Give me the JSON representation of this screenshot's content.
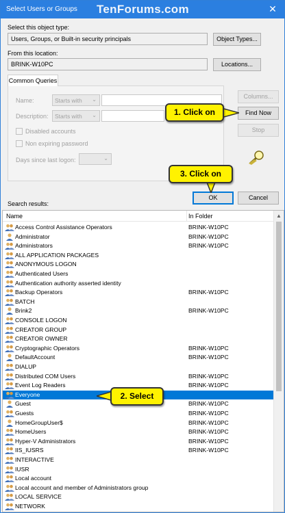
{
  "window": {
    "title": "Select Users or Groups",
    "watermark": "TenForums.com",
    "close_glyph": "✕"
  },
  "object_type": {
    "label": "Select this object type:",
    "value": "Users, Groups, or Built-in security principals",
    "button": "Object Types..."
  },
  "location": {
    "label": "From this location:",
    "value": "BRINK-W10PC",
    "button": "Locations..."
  },
  "common_queries": {
    "tab": "Common Queries",
    "name_label": "Name:",
    "name_mode": "Starts with",
    "description_label": "Description:",
    "description_mode": "Starts with",
    "disabled_accounts": "Disabled accounts",
    "non_expiring_password": "Non expiring password",
    "days_label": "Days since last logon:"
  },
  "side_buttons": {
    "columns": "Columns...",
    "find_now": "Find Now",
    "stop": "Stop"
  },
  "actions": {
    "ok": "OK",
    "cancel": "Cancel"
  },
  "callouts": {
    "step1": "1. Click on",
    "step2": "2. Select",
    "step3": "3. Click on"
  },
  "results": {
    "label": "Search results:",
    "col_name": "Name",
    "col_folder": "In Folder",
    "selected_index": 18,
    "rows": [
      {
        "name": "Access Control Assistance Operators",
        "folder": "BRINK-W10PC",
        "icon": "group-icon"
      },
      {
        "name": "Administrator",
        "folder": "BRINK-W10PC",
        "icon": "user-icon"
      },
      {
        "name": "Administrators",
        "folder": "BRINK-W10PC",
        "icon": "group-icon"
      },
      {
        "name": "ALL APPLICATION PACKAGES",
        "folder": "",
        "icon": "group-icon"
      },
      {
        "name": "ANONYMOUS LOGON",
        "folder": "",
        "icon": "group-icon"
      },
      {
        "name": "Authenticated Users",
        "folder": "",
        "icon": "group-icon"
      },
      {
        "name": "Authentication authority asserted identity",
        "folder": "",
        "icon": "group-icon"
      },
      {
        "name": "Backup Operators",
        "folder": "BRINK-W10PC",
        "icon": "group-icon"
      },
      {
        "name": "BATCH",
        "folder": "",
        "icon": "group-icon"
      },
      {
        "name": "Brink2",
        "folder": "BRINK-W10PC",
        "icon": "user-icon"
      },
      {
        "name": "CONSOLE LOGON",
        "folder": "",
        "icon": "group-icon"
      },
      {
        "name": "CREATOR GROUP",
        "folder": "",
        "icon": "group-icon"
      },
      {
        "name": "CREATOR OWNER",
        "folder": "",
        "icon": "group-icon"
      },
      {
        "name": "Cryptographic Operators",
        "folder": "BRINK-W10PC",
        "icon": "group-icon"
      },
      {
        "name": "DefaultAccount",
        "folder": "BRINK-W10PC",
        "icon": "user-icon"
      },
      {
        "name": "DIALUP",
        "folder": "",
        "icon": "group-icon"
      },
      {
        "name": "Distributed COM Users",
        "folder": "BRINK-W10PC",
        "icon": "group-icon"
      },
      {
        "name": "Event Log Readers",
        "folder": "BRINK-W10PC",
        "icon": "group-icon"
      },
      {
        "name": "Everyone",
        "folder": "",
        "icon": "group-icon"
      },
      {
        "name": "Guest",
        "folder": "BRINK-W10PC",
        "icon": "user-icon"
      },
      {
        "name": "Guests",
        "folder": "BRINK-W10PC",
        "icon": "group-icon"
      },
      {
        "name": "HomeGroupUser$",
        "folder": "BRINK-W10PC",
        "icon": "user-icon"
      },
      {
        "name": "HomeUsers",
        "folder": "BRINK-W10PC",
        "icon": "group-icon"
      },
      {
        "name": "Hyper-V Administrators",
        "folder": "BRINK-W10PC",
        "icon": "group-icon"
      },
      {
        "name": "IIS_IUSRS",
        "folder": "BRINK-W10PC",
        "icon": "group-icon"
      },
      {
        "name": "INTERACTIVE",
        "folder": "",
        "icon": "group-icon"
      },
      {
        "name": "IUSR",
        "folder": "",
        "icon": "group-icon"
      },
      {
        "name": "Local account",
        "folder": "",
        "icon": "group-icon"
      },
      {
        "name": "Local account and member of Administrators group",
        "folder": "",
        "icon": "group-icon"
      },
      {
        "name": "LOCAL SERVICE",
        "folder": "",
        "icon": "group-icon"
      },
      {
        "name": "NETWORK",
        "folder": "",
        "icon": "group-icon"
      }
    ]
  }
}
